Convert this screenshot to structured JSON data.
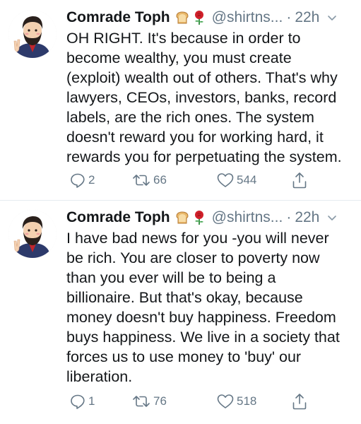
{
  "tweets": [
    {
      "display_name": "Comrade Toph",
      "emoji": [
        "bread-icon",
        "rose-icon"
      ],
      "handle": "@shirtns...",
      "separator": "·",
      "time": "22h",
      "text": "OH RIGHT. It's because in order to\nbecome wealthy, you must create\n(exploit) wealth out of others. That's why\nlawyers, CEOs, investors, banks, record\nlabels, are the rich ones. The system\ndoesn't reward you for working hard, it\nrewards you for perpetuating the system.",
      "replies": "2",
      "retweets": "66",
      "likes": "544"
    },
    {
      "display_name": "Comrade Toph",
      "emoji": [
        "bread-icon",
        "rose-icon"
      ],
      "handle": "@shirtns...",
      "separator": "·",
      "time": "22h",
      "text": "I have bad news for you -you will never\nbe rich. You are closer to poverty now\nthan you ever will be to being a\nbillionaire. But that's okay, because\nmoney doesn't buy happiness. Freedom\nbuys happiness. We live in a society that\nforces us to use money to 'buy' our\nliberation.",
      "replies": "1",
      "retweets": "76",
      "likes": "518"
    }
  ],
  "colors": {
    "text": "#14171a",
    "secondary": "#657786",
    "divider": "#e6ecf0"
  }
}
